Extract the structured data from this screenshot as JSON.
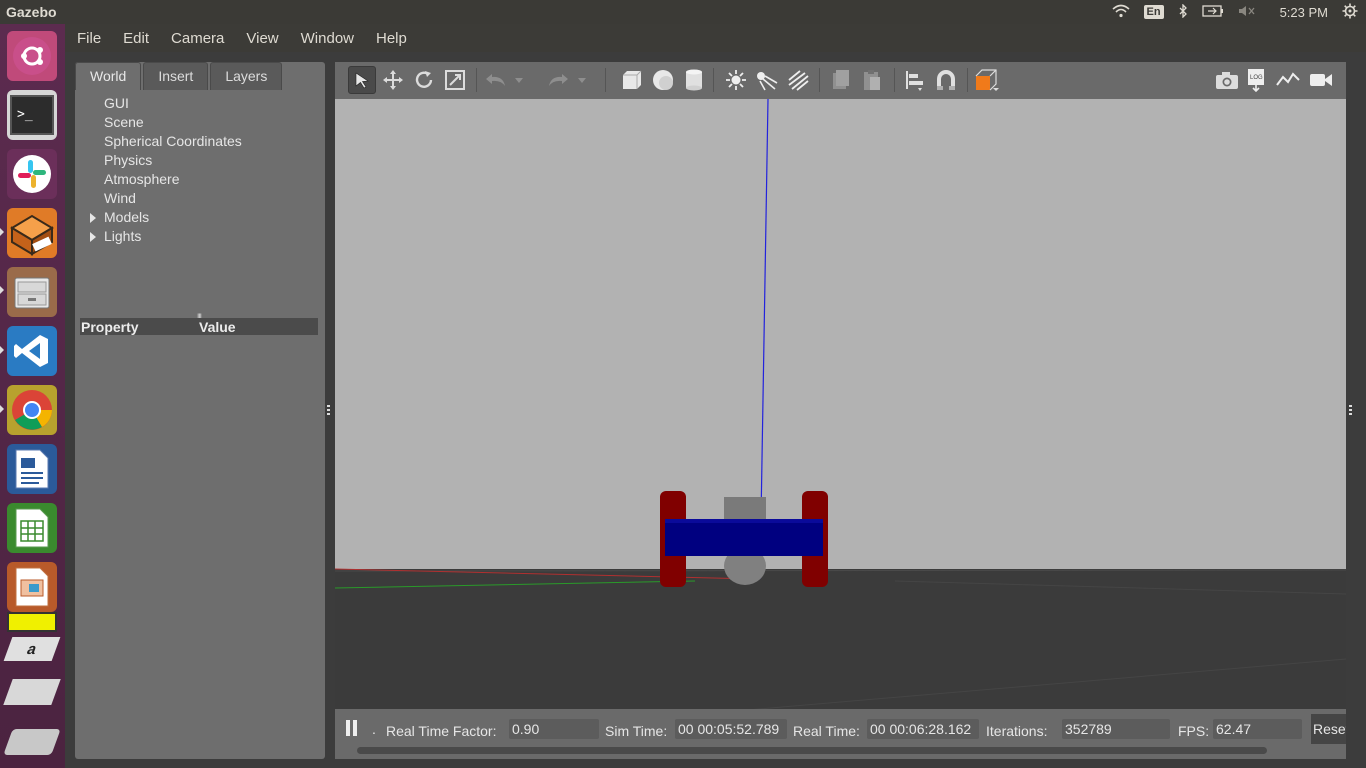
{
  "app": {
    "title": "Gazebo"
  },
  "tray": {
    "lang": "En",
    "time": "5:23 PM"
  },
  "launcher": {
    "items": [
      "ubuntu-dash",
      "terminal",
      "slack",
      "gazebo",
      "files",
      "vscode",
      "chrome",
      "writer",
      "calc",
      "impress",
      "workspace",
      "amazon",
      "text-editor",
      "dvd"
    ]
  },
  "menu": [
    "File",
    "Edit",
    "Camera",
    "View",
    "Window",
    "Help"
  ],
  "left_panel": {
    "tabs": [
      "World",
      "Insert",
      "Layers"
    ],
    "active_tab": "World",
    "tree": [
      {
        "label": "GUI",
        "expandable": false
      },
      {
        "label": "Scene",
        "expandable": false
      },
      {
        "label": "Spherical Coordinates",
        "expandable": false
      },
      {
        "label": "Physics",
        "expandable": false
      },
      {
        "label": "Atmosphere",
        "expandable": false
      },
      {
        "label": "Wind",
        "expandable": false
      },
      {
        "label": "Models",
        "expandable": true
      },
      {
        "label": "Lights",
        "expandable": true
      }
    ],
    "property_header": {
      "property": "Property",
      "value": "Value"
    }
  },
  "toolbar": {
    "tools": [
      "select-mode",
      "translate-mode",
      "rotate-mode",
      "scale-mode",
      "undo",
      "undo-dropdown",
      "redo",
      "redo-dropdown",
      "box-shape",
      "sphere-shape",
      "cylinder-shape",
      "point-light",
      "spot-light",
      "directional-light",
      "copy",
      "paste",
      "align",
      "snap",
      "view-angle",
      "screenshot",
      "log",
      "plot",
      "record-video"
    ],
    "active_tool": "select-mode"
  },
  "status": {
    "real_time_factor_label": "Real Time Factor:",
    "real_time_factor": "0.90",
    "sim_time_label": "Sim Time:",
    "sim_time": "00 00:05:52.789",
    "real_time_label": "Real Time:",
    "real_time": "00 00:06:28.162",
    "iterations_label": "Iterations:",
    "iterations": "352789",
    "fps_label": "FPS:",
    "fps": "62.47",
    "reset_label": "Reset",
    "step_dot": "."
  },
  "colors": {
    "sky": "#b2b2b2",
    "ground": "#3b3b3b",
    "robot_body": "#000080",
    "robot_wheel": "#800000",
    "caster": "#808080",
    "z_axis": "#2222dd"
  }
}
